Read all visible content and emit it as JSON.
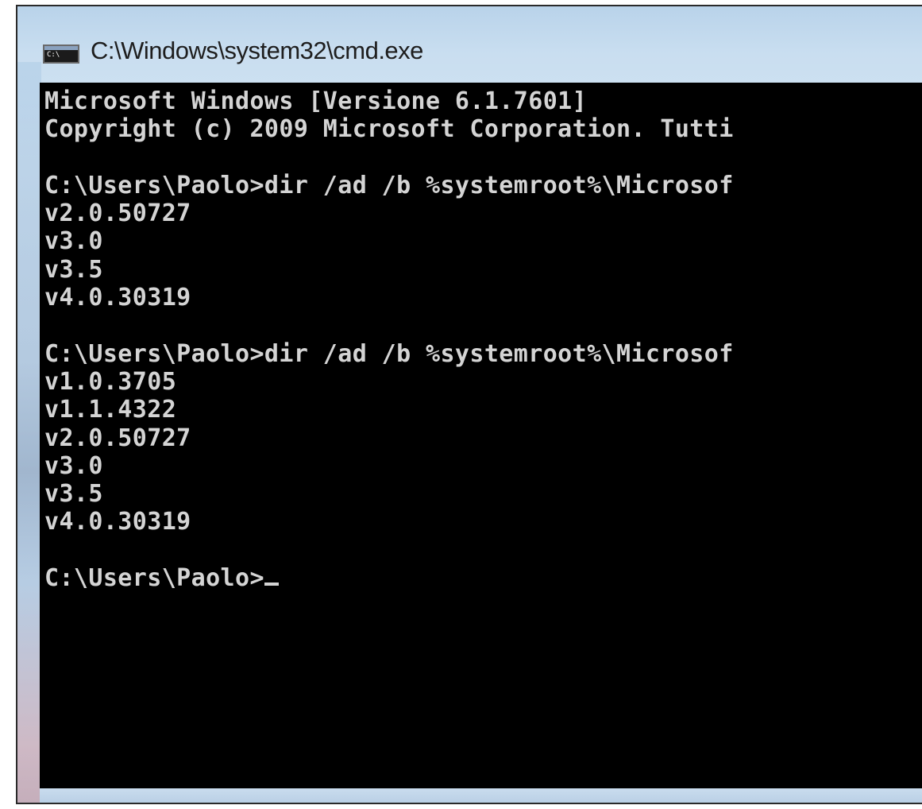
{
  "window": {
    "title": "C:\\Windows\\system32\\cmd.exe",
    "icon": "cmd-icon"
  },
  "console": {
    "lines": [
      "Microsoft Windows [Versione 6.1.7601]",
      "Copyright (c) 2009 Microsoft Corporation. Tutti",
      "",
      "C:\\Users\\Paolo>dir /ad /b %systemroot%\\Microsof",
      "v2.0.50727",
      "v3.0",
      "v3.5",
      "v4.0.30319",
      "",
      "C:\\Users\\Paolo>dir /ad /b %systemroot%\\Microsof",
      "v1.0.3705",
      "v1.1.4322",
      "v2.0.50727",
      "v3.0",
      "v3.5",
      "v4.0.30319",
      ""
    ],
    "prompt": "C:\\Users\\Paolo>"
  },
  "colors": {
    "console_background": "#000000",
    "console_text": "#d4d4d4",
    "titlebar": "#c9def0"
  }
}
